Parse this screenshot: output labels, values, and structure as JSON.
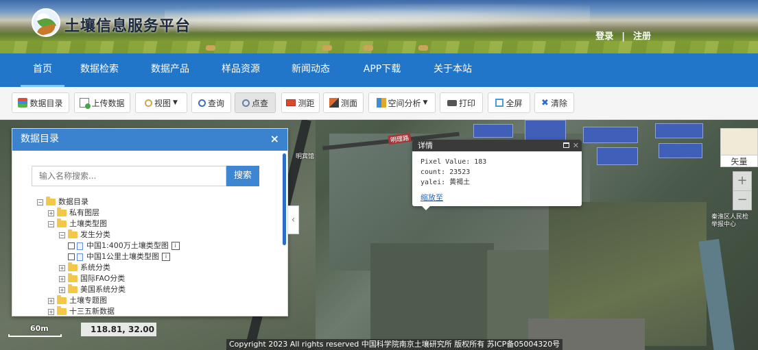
{
  "header": {
    "site_title": "土壤信息服务平台",
    "login": "登录",
    "separator": "|",
    "register": "注册"
  },
  "nav": {
    "items": [
      {
        "label": "首页",
        "active": true
      },
      {
        "label": "数据检索"
      },
      {
        "label": "数据产品"
      },
      {
        "label": "样品资源"
      },
      {
        "label": "新闻动态"
      },
      {
        "label": "APP下载"
      },
      {
        "label": "关于本站"
      }
    ]
  },
  "toolbar": {
    "catalog": "数据目录",
    "upload": "上传数据",
    "view": "视图",
    "query": "查询",
    "point_query": "点查",
    "measure_distance": "测距",
    "measure_area": "测面",
    "spatial_analysis": "空间分析",
    "print": "打印",
    "fullscreen": "全屏",
    "clear": "清除"
  },
  "catalog_panel": {
    "title": "数据目录",
    "close": "×",
    "search_placeholder": "输入名称搜索...",
    "search_button": "搜索",
    "tree": [
      {
        "label": "数据目录",
        "level": 0,
        "expander": "−"
      },
      {
        "label": "私有图层",
        "level": 1,
        "expander": "+"
      },
      {
        "label": "土壤类型图",
        "level": 1,
        "expander": "−"
      },
      {
        "label": "发生分类",
        "level": 2,
        "expander": "−"
      },
      {
        "label": "中国1:400万土壤类型图",
        "level": 3,
        "leaf": true
      },
      {
        "label": "中国1公里土壤类型图",
        "level": 3,
        "leaf": true
      },
      {
        "label": "系统分类",
        "level": 2,
        "expander": "+"
      },
      {
        "label": "国际FAO分类",
        "level": 2,
        "expander": "+"
      },
      {
        "label": "美国系统分类",
        "level": 2,
        "expander": "+"
      },
      {
        "label": "土壤专题图",
        "level": 1,
        "expander": "+"
      },
      {
        "label": "十三五新数据",
        "level": 1,
        "expander": "+"
      }
    ]
  },
  "popup": {
    "title": "详情",
    "pixel_value": "Pixel Value: 183",
    "count": "count: 23523",
    "yalei": "yalei: 黄褐土",
    "zoom_link": "缩放至"
  },
  "map": {
    "road_label": "明理路",
    "building_label": "明宾馆",
    "poi_label_line1": "秦淮区人民检",
    "poi_label_line2": "举报中心",
    "layer_toggle": "矢量",
    "zoom_in": "+",
    "zoom_out": "−",
    "scale": "60m",
    "coordinates": "118.81, 32.00",
    "copyright": "Copyright 2023 All rights reserved 中国科学院南京土壤研究所 版权所有 苏ICP备05004320号"
  },
  "colors": {
    "nav_bg": "#2176c9",
    "panel_header": "#3b83cf",
    "search_button": "#3f86d2",
    "popup_header": "#3a3a3a"
  }
}
